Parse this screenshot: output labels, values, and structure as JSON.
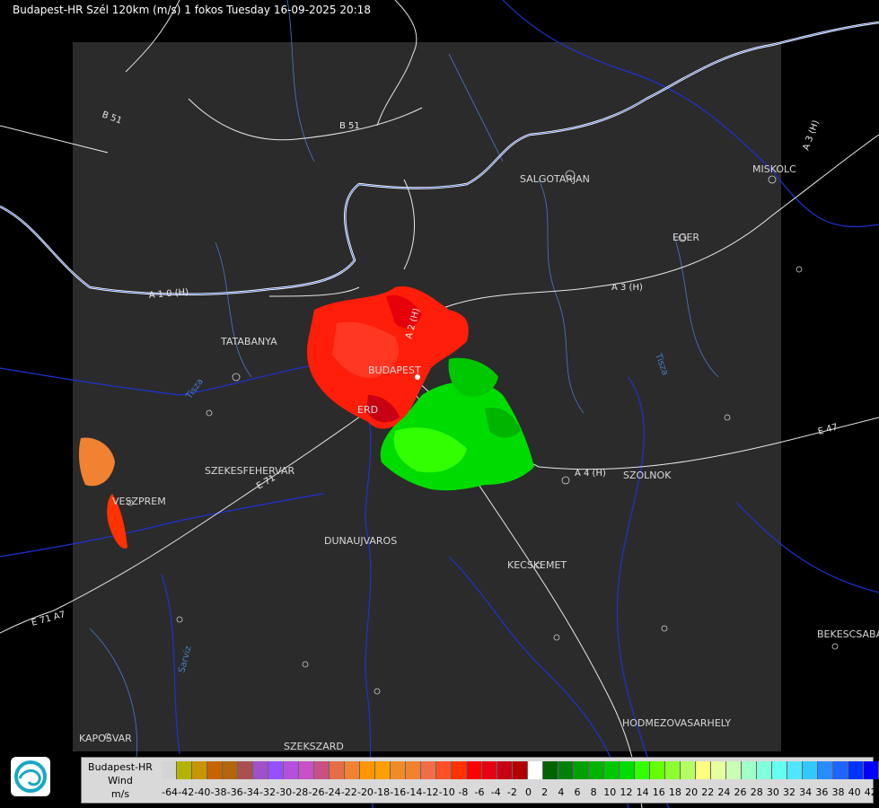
{
  "header": {
    "title": "Budapest-HR Szél 120km (m/s) 1 fokos Tuesday 16-09-2025 20:18"
  },
  "cities": [
    {
      "name": "SALGOTARJAN"
    },
    {
      "name": "MISKOLC"
    },
    {
      "name": "EGER"
    },
    {
      "name": "TATABANYA"
    },
    {
      "name": "BUDAPEST"
    },
    {
      "name": "ERD"
    },
    {
      "name": "SZEKESFEHERVAR"
    },
    {
      "name": "VESZPREM"
    },
    {
      "name": "DUNAUJVAROS"
    },
    {
      "name": "KECSKEMET"
    },
    {
      "name": "SZOLNOK"
    },
    {
      "name": "BEKESCSABA"
    },
    {
      "name": "HODMEZOVASARHELY"
    },
    {
      "name": "KAPOSVAR"
    },
    {
      "name": "SZEKSZARD"
    }
  ],
  "roads": [
    {
      "name": "B 51"
    },
    {
      "name": "B 51"
    },
    {
      "name": "A 1 0 (H)"
    },
    {
      "name": "A 2 (H)"
    },
    {
      "name": "A 3 (H)"
    },
    {
      "name": "A 3 (H)"
    },
    {
      "name": "E 71"
    },
    {
      "name": "E 71 A7"
    },
    {
      "name": "A 4 (H)"
    },
    {
      "name": "E 47"
    },
    {
      "name": "A 3 (H)"
    }
  ],
  "rivers": [
    {
      "name": "Tisza"
    },
    {
      "name": "Tisza"
    },
    {
      "name": "Sarviz"
    }
  ],
  "legend": {
    "station": "Budapest-HR",
    "product": "Wind",
    "unit": "m/s",
    "colors": [
      "#d4d4d4",
      "#b4b400",
      "#c89600",
      "#c86400",
      "#b4640a",
      "#aa5050",
      "#a050c8",
      "#9650ff",
      "#b450dc",
      "#c850c8",
      "#c85082",
      "#e66e46",
      "#f08232",
      "#ff9600",
      "#ffa000",
      "#f08c28",
      "#f08232",
      "#f06e46",
      "#ff5028",
      "#ff3200",
      "#ff0000",
      "#e60014",
      "#c80014",
      "#b40000",
      "#ffffff",
      "#006400",
      "#00800a",
      "#00a000",
      "#00b400",
      "#00c800",
      "#00dc00",
      "#32ff00",
      "#64ff00",
      "#8cff32",
      "#b4ff64",
      "#ffff80",
      "#e6ffa0",
      "#c8ffb4",
      "#a0ffc8",
      "#80ffdc",
      "#64fff0",
      "#50e6ff",
      "#32c8ff",
      "#288cff",
      "#1e64ff",
      "#0032ff",
      "#0000ff"
    ],
    "ticks": [
      "-64",
      "-42",
      "-40",
      "-38",
      "-36",
      "-34",
      "-32",
      "-30",
      "-28",
      "-26",
      "-24",
      "-22",
      "-20",
      "-18",
      "-16",
      "-14",
      "-12",
      "-10",
      "-8",
      "-6",
      "-4",
      "-2",
      "0",
      "2",
      "4",
      "6",
      "8",
      "10",
      "12",
      "14",
      "16",
      "18",
      "20",
      "22",
      "24",
      "26",
      "28",
      "30",
      "32",
      "34",
      "36",
      "38",
      "40",
      "42"
    ]
  }
}
